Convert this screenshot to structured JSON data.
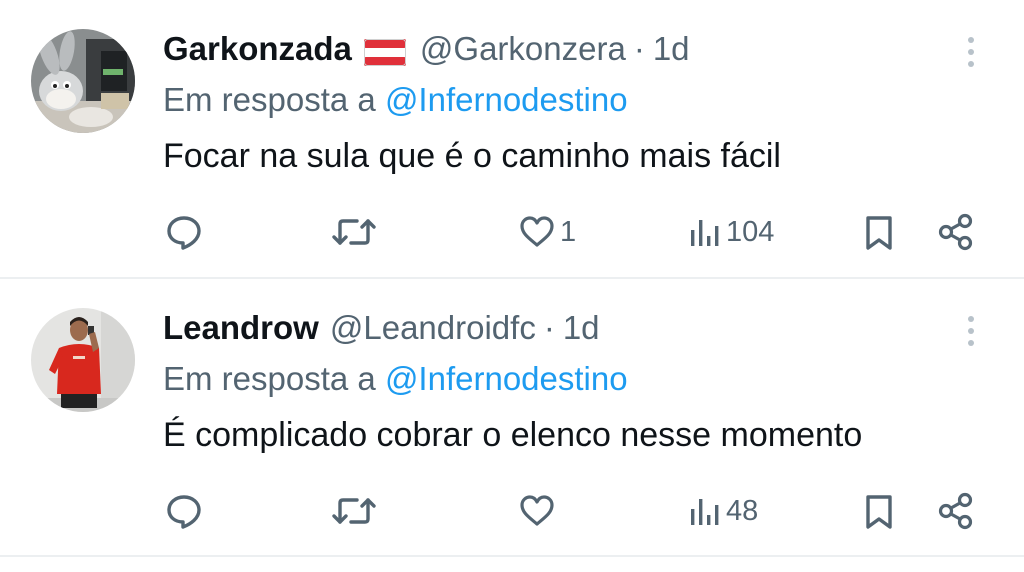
{
  "tweets": [
    {
      "display_name": "Garkonzada",
      "flag": "austria-flag",
      "handle": "@Garkonzera",
      "separator": "·",
      "time": "1d",
      "reply_prefix": "Em resposta a",
      "reply_to": "@Infernodestino",
      "text": "Focar na sula que é o caminho mais fácil",
      "likes": "1",
      "views": "104",
      "avatar": "bugs-bunny-avatar"
    },
    {
      "display_name": "Leandrow",
      "handle": "@Leandroidfc",
      "separator": "·",
      "time": "1d",
      "reply_prefix": "Em resposta a",
      "reply_to": "@Infernodestino",
      "text": "É complicado cobrar o elenco nesse momento",
      "likes": "",
      "views": "48",
      "avatar": "man-red-jersey-avatar"
    }
  ],
  "icons": {
    "reply": "reply-icon",
    "retweet": "retweet-icon",
    "like": "heart-icon",
    "views": "views-icon",
    "bookmark": "bookmark-icon",
    "share": "share-icon",
    "more": "more-icon"
  },
  "colors": {
    "text_primary": "#0f1419",
    "text_secondary": "#536471",
    "mention": "#1d9bf0",
    "divider": "#eceff1",
    "flag_red": "#e0303a"
  }
}
